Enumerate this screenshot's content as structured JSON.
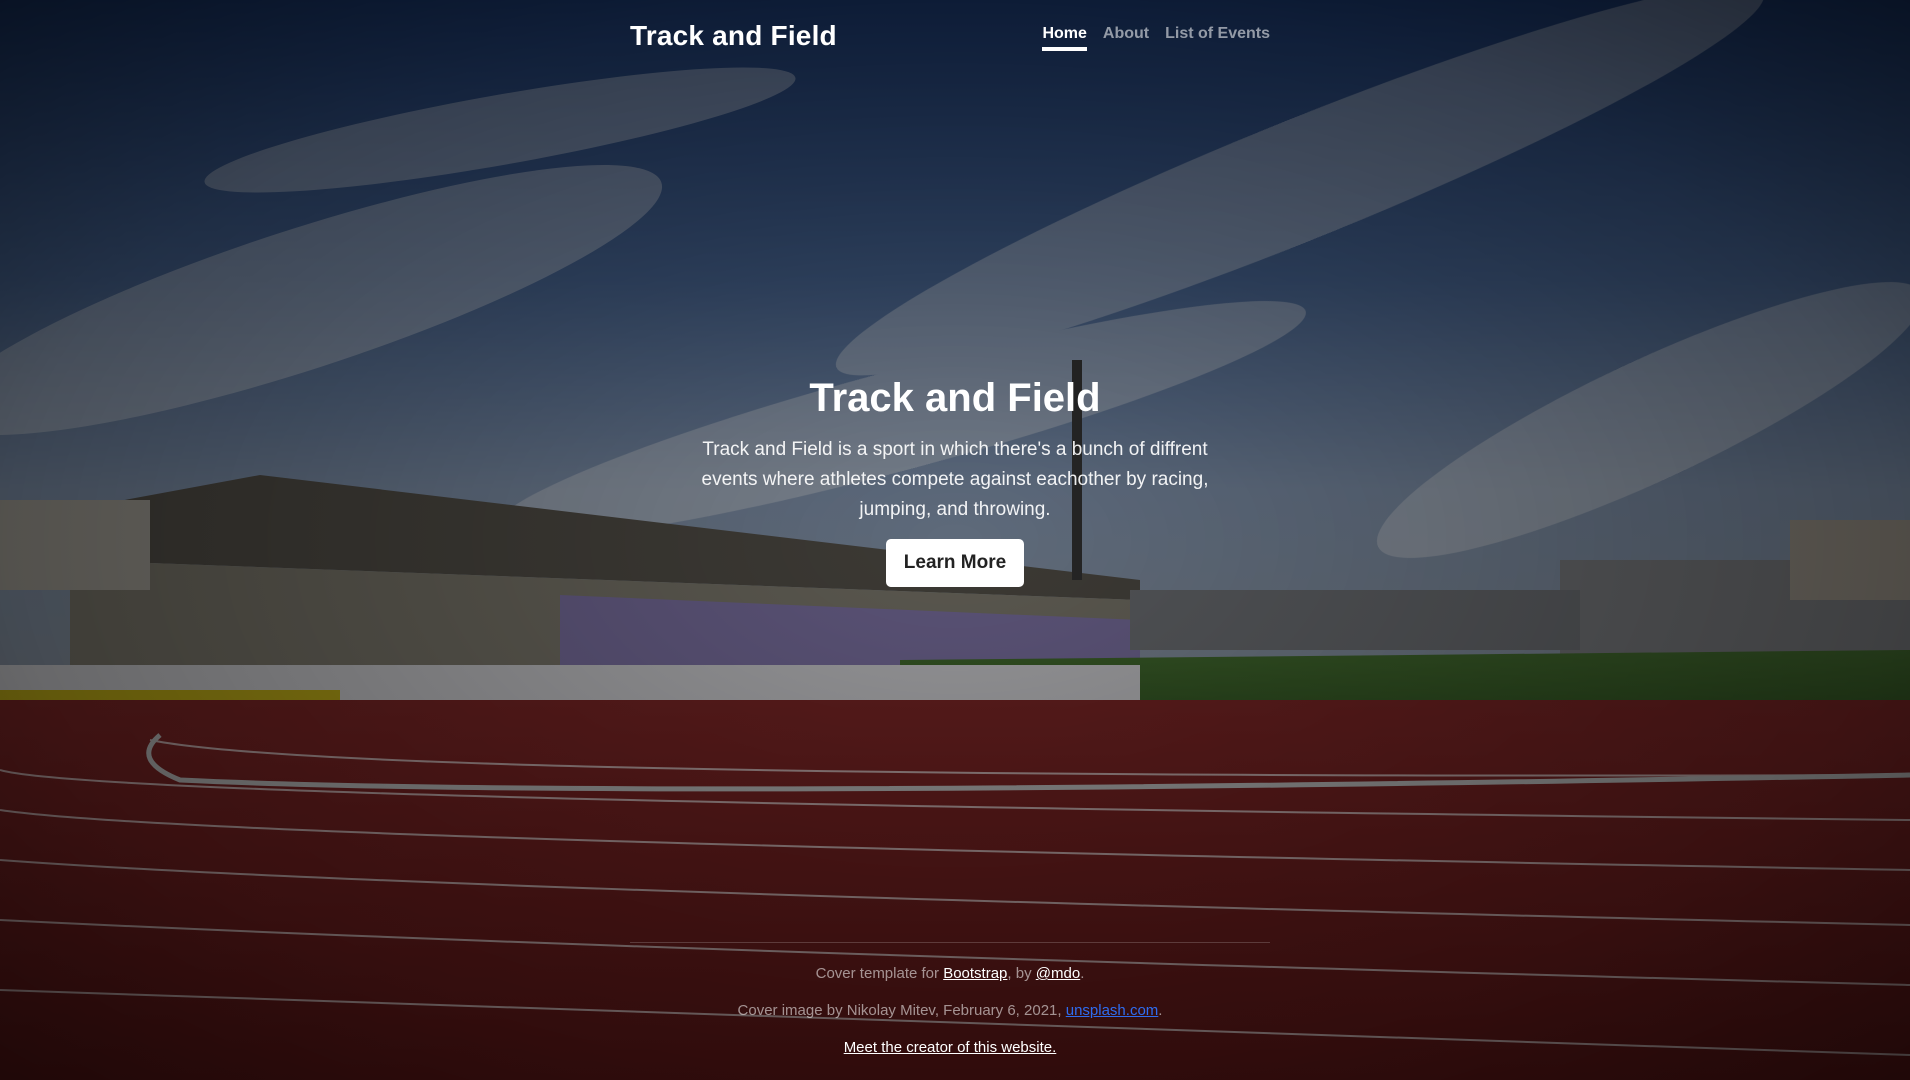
{
  "header": {
    "brand": "Track and Field",
    "nav": [
      {
        "label": "Home",
        "active": true
      },
      {
        "label": "About",
        "active": false
      },
      {
        "label": "List of Events",
        "active": false
      }
    ]
  },
  "hero": {
    "title": "Track and Field",
    "lead": "Track and Field is a sport in which there's a bunch of diffrent events where athletes compete against eachother by racing, jumping, and throwing.",
    "button_label": "Learn More"
  },
  "footer": {
    "line1_prefix": "Cover template for ",
    "line1_link1": "Bootstrap",
    "line1_mid": ", by ",
    "line1_link2": "@mdo",
    "line1_suffix": ".",
    "line2_prefix": "Cover image by Nikolay Mitev, February 6, 2021, ",
    "line2_link": "unsplash.com",
    "line2_suffix": ".",
    "line3_link": "Meet the creator of this website."
  },
  "colors": {
    "accent_link": "#2f6cf0",
    "track": "#7a2424",
    "sky": "#3d5a8f",
    "grass": "#3d6b2e"
  },
  "background_image": "stadium-track-photo"
}
